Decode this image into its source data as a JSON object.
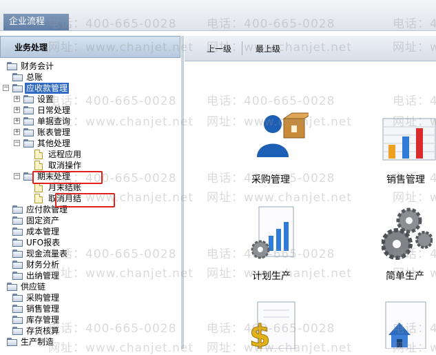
{
  "window": {
    "tab_label": "企业流程"
  },
  "left_panel": {
    "title": "业务处理"
  },
  "tree": [
    {
      "label": "财务会计",
      "level": 0,
      "icon": "folder",
      "expander": ""
    },
    {
      "label": "总账",
      "level": 1,
      "icon": "folder",
      "expander": ""
    },
    {
      "label": "应收款管理",
      "level": 1,
      "icon": "folder",
      "expander": "minus",
      "selected": true
    },
    {
      "label": "设置",
      "level": 2,
      "icon": "folder",
      "expander": "plus"
    },
    {
      "label": "日常处理",
      "level": 2,
      "icon": "folder",
      "expander": "plus"
    },
    {
      "label": "单据查询",
      "level": 2,
      "icon": "folder",
      "expander": "plus"
    },
    {
      "label": "账表管理",
      "level": 2,
      "icon": "folder",
      "expander": "plus"
    },
    {
      "label": "其他处理",
      "level": 2,
      "icon": "folder",
      "expander": "minus"
    },
    {
      "label": "远程应用",
      "level": 3,
      "icon": "doc",
      "expander": ""
    },
    {
      "label": "取消操作",
      "level": 3,
      "icon": "doc",
      "expander": ""
    },
    {
      "label": "期末处理",
      "level": 2,
      "icon": "folder",
      "expander": "minus",
      "highlighted": true
    },
    {
      "label": "月末结账",
      "level": 3,
      "icon": "doc",
      "expander": ""
    },
    {
      "label": "取消月结",
      "level": 3,
      "icon": "doc",
      "expander": "",
      "highlighted": true
    },
    {
      "label": "应付款管理",
      "level": 1,
      "icon": "folder",
      "expander": ""
    },
    {
      "label": "固定资产",
      "level": 1,
      "icon": "folder",
      "expander": ""
    },
    {
      "label": "成本管理",
      "level": 1,
      "icon": "folder",
      "expander": ""
    },
    {
      "label": "UFO报表",
      "level": 1,
      "icon": "folder",
      "expander": ""
    },
    {
      "label": "现金流量表",
      "level": 1,
      "icon": "folder",
      "expander": ""
    },
    {
      "label": "财务分析",
      "level": 1,
      "icon": "folder",
      "expander": ""
    },
    {
      "label": "出纳管理",
      "level": 1,
      "icon": "folder",
      "expander": ""
    },
    {
      "label": "供应链",
      "level": 0,
      "icon": "folder",
      "expander": ""
    },
    {
      "label": "采购管理",
      "level": 1,
      "icon": "folder",
      "expander": ""
    },
    {
      "label": "销售管理",
      "level": 1,
      "icon": "folder",
      "expander": ""
    },
    {
      "label": "库存管理",
      "level": 1,
      "icon": "folder",
      "expander": ""
    },
    {
      "label": "存货核算",
      "level": 1,
      "icon": "folder",
      "expander": ""
    },
    {
      "label": "生产制造",
      "level": 0,
      "icon": "folder",
      "expander": ""
    }
  ],
  "toolbar": {
    "up_label": "上一级",
    "top_label": "最上级"
  },
  "modules": [
    {
      "label": "采购管理",
      "icon": "purchase-icon"
    },
    {
      "label": "销售管理",
      "icon": "sales-chart-icon"
    },
    {
      "label": "计划生产",
      "icon": "plan-production-icon"
    },
    {
      "label": "简单生产",
      "icon": "simple-production-gears-icon"
    },
    {
      "label": "",
      "icon": "dollar-document-icon"
    },
    {
      "label": "",
      "icon": "house-icon"
    }
  ],
  "watermark": {
    "phone": "电话：400-665-0028",
    "site": "网址：www.chanjet.net"
  },
  "colors": {
    "selected": "#316ac5",
    "highlight": "#e0201b",
    "header": "#b7c9de"
  }
}
